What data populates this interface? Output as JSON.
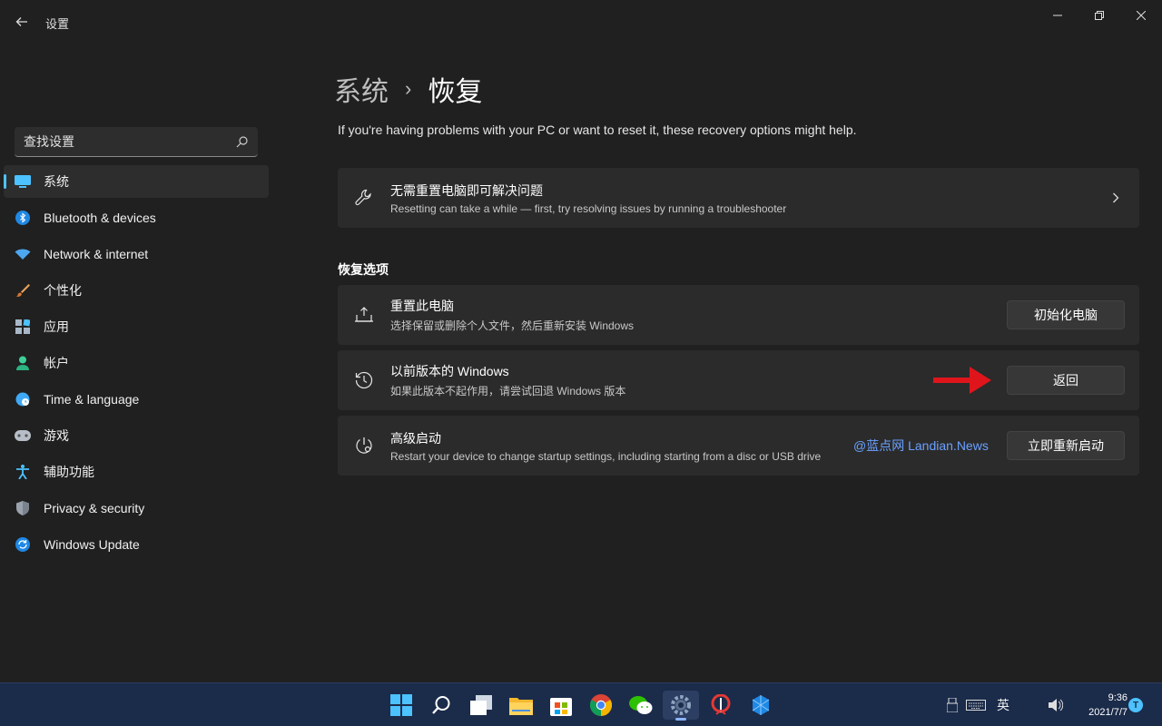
{
  "window": {
    "title": "设置",
    "minimize_symbol": "—",
    "maximize_symbol": "❐",
    "close_symbol": "✕"
  },
  "search": {
    "placeholder": "查找设置"
  },
  "sidebar": {
    "items": [
      {
        "label": "系统",
        "icon": "system-display-icon",
        "active": true
      },
      {
        "label": "Bluetooth & devices",
        "icon": "bluetooth-icon"
      },
      {
        "label": "Network & internet",
        "icon": "wifi-icon"
      },
      {
        "label": "个性化",
        "icon": "brush-icon"
      },
      {
        "label": "应用",
        "icon": "apps-icon"
      },
      {
        "label": "帐户",
        "icon": "account-icon"
      },
      {
        "label": "Time & language",
        "icon": "globe-clock-icon"
      },
      {
        "label": "游戏",
        "icon": "gamepad-icon"
      },
      {
        "label": "辅助功能",
        "icon": "accessibility-icon"
      },
      {
        "label": "Privacy & security",
        "icon": "shield-icon"
      },
      {
        "label": "Windows Update",
        "icon": "update-icon"
      }
    ]
  },
  "main": {
    "breadcrumb": {
      "parent": "系统",
      "separator": "›",
      "current": "恢复"
    },
    "intro": "If you're having problems with your PC or want to reset it, these recovery options might help.",
    "troubleshoot": {
      "title": "无需重置电脑即可解决问题",
      "subtitle": "Resetting can take a while — first, try resolving issues by running a troubleshooter"
    },
    "section_title": "恢复选项",
    "options": [
      {
        "title": "重置此电脑",
        "subtitle": "选择保留或删除个人文件，然后重新安装 Windows",
        "button": "初始化电脑",
        "icon": "reset-pc-icon"
      },
      {
        "title": "以前版本的 Windows",
        "subtitle": "如果此版本不起作用，请尝试回退 Windows 版本",
        "button": "返回",
        "icon": "history-icon"
      },
      {
        "title": "高级启动",
        "subtitle": "Restart your device to change startup settings, including starting from a disc or USB drive",
        "button": "立即重新启动",
        "icon": "advanced-startup-icon"
      }
    ],
    "watermark": "@蓝点网 Landian.News"
  },
  "taskbar": {
    "apps": [
      "start",
      "search",
      "task-view",
      "file-explorer",
      "store",
      "chrome",
      "wechat",
      "settings",
      "app-red",
      "app-blue"
    ],
    "active_app": "settings",
    "ime_label": "英",
    "time": "9:36",
    "date": "2021/7/7",
    "notification_badge": "T"
  },
  "colors": {
    "background": "#202020",
    "card": "#2b2b2b",
    "accent": "#4cc2ff",
    "taskbar": "#1b2b4a",
    "arrow": "#e0151b"
  }
}
